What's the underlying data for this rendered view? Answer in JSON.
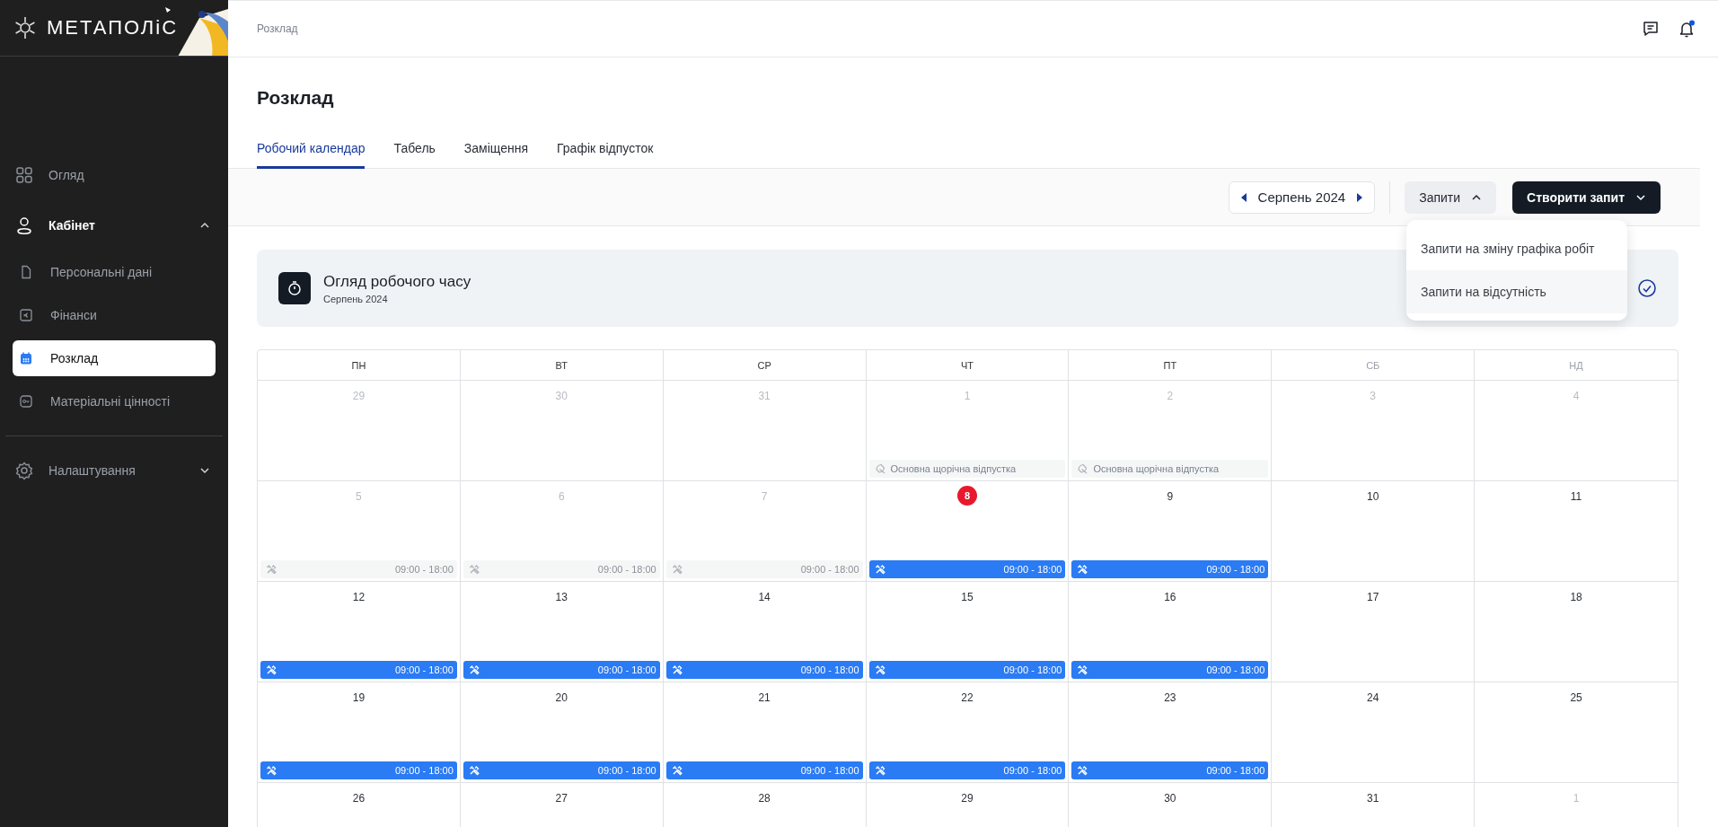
{
  "sidebar": {
    "logo": "МЕТАПОЛіС",
    "items": [
      {
        "label": "Огляд",
        "selected": false
      },
      {
        "label": "Кабінет",
        "selected": false,
        "expanded": true,
        "children": [
          {
            "label": "Персональні дані",
            "selected": false
          },
          {
            "label": "Фінанси",
            "selected": false
          },
          {
            "label": "Розклад",
            "selected": true
          },
          {
            "label": "Матеріальні цінності",
            "selected": false
          }
        ]
      },
      {
        "label": "Налаштування",
        "selected": false,
        "expanded": false
      }
    ]
  },
  "header": {
    "breadcrumb": "Розклад",
    "notifications": {
      "unread": true
    }
  },
  "page_title": "Розклад",
  "tabs": [
    {
      "label": "Робочий календар",
      "selected": true
    },
    {
      "label": "Табель",
      "selected": false
    },
    {
      "label": "Заміщення",
      "selected": false
    },
    {
      "label": "Графік відпусток",
      "selected": false
    }
  ],
  "toolbar": {
    "month": "Серпень 2024",
    "requests_button": {
      "label": "Запити",
      "expanded": true
    },
    "create_button": {
      "label": "Створити запит"
    },
    "requests_menu": [
      {
        "label": "Запити на зміну графіка робіт",
        "highlighted": false
      },
      {
        "label": "Запити на відсутність",
        "highlighted": true
      }
    ]
  },
  "overview": {
    "title": "Огляд робочого часу",
    "subtitle": "Серпень 2024"
  },
  "calendar": {
    "weekdays": [
      {
        "label": "ПН",
        "weekend": false
      },
      {
        "label": "ВТ",
        "weekend": false
      },
      {
        "label": "СР",
        "weekend": false
      },
      {
        "label": "ЧТ",
        "weekend": false
      },
      {
        "label": "ПТ",
        "weekend": false
      },
      {
        "label": "СБ",
        "weekend": true
      },
      {
        "label": "НД",
        "weekend": true
      }
    ],
    "weeks": [
      [
        {
          "number": "29",
          "muted": true,
          "today": false
        },
        {
          "number": "30",
          "muted": true,
          "today": false
        },
        {
          "number": "31",
          "muted": true,
          "today": false
        },
        {
          "number": "1",
          "muted": true,
          "today": false,
          "event": {
            "kind": "vacation",
            "label": "Основна щорічна відпустка"
          }
        },
        {
          "number": "2",
          "muted": true,
          "today": false,
          "event": {
            "kind": "vacation",
            "label": "Основна щорічна відпустка"
          }
        },
        {
          "number": "3",
          "muted": true,
          "today": false
        },
        {
          "number": "4",
          "muted": true,
          "today": false
        }
      ],
      [
        {
          "number": "5",
          "muted": true,
          "today": false,
          "event": {
            "kind": "shift",
            "time": "09:00 - 18:00",
            "past": true
          }
        },
        {
          "number": "6",
          "muted": true,
          "today": false,
          "event": {
            "kind": "shift",
            "time": "09:00 - 18:00",
            "past": true
          }
        },
        {
          "number": "7",
          "muted": true,
          "today": false,
          "event": {
            "kind": "shift",
            "time": "09:00 - 18:00",
            "past": true
          }
        },
        {
          "number": "8",
          "muted": false,
          "today": true,
          "event": {
            "kind": "shift",
            "time": "09:00 - 18:00",
            "past": false
          }
        },
        {
          "number": "9",
          "muted": false,
          "today": false,
          "event": {
            "kind": "shift",
            "time": "09:00 - 18:00",
            "past": false
          }
        },
        {
          "number": "10",
          "muted": false,
          "today": false
        },
        {
          "number": "11",
          "muted": false,
          "today": false
        }
      ],
      [
        {
          "number": "12",
          "muted": false,
          "today": false,
          "event": {
            "kind": "shift",
            "time": "09:00 - 18:00",
            "past": false
          }
        },
        {
          "number": "13",
          "muted": false,
          "today": false,
          "event": {
            "kind": "shift",
            "time": "09:00 - 18:00",
            "past": false
          }
        },
        {
          "number": "14",
          "muted": false,
          "today": false,
          "event": {
            "kind": "shift",
            "time": "09:00 - 18:00",
            "past": false
          }
        },
        {
          "number": "15",
          "muted": false,
          "today": false,
          "event": {
            "kind": "shift",
            "time": "09:00 - 18:00",
            "past": false
          }
        },
        {
          "number": "16",
          "muted": false,
          "today": false,
          "event": {
            "kind": "shift",
            "time": "09:00 - 18:00",
            "past": false
          }
        },
        {
          "number": "17",
          "muted": false,
          "today": false
        },
        {
          "number": "18",
          "muted": false,
          "today": false
        }
      ],
      [
        {
          "number": "19",
          "muted": false,
          "today": false,
          "event": {
            "kind": "shift",
            "time": "09:00 - 18:00",
            "past": false
          }
        },
        {
          "number": "20",
          "muted": false,
          "today": false,
          "event": {
            "kind": "shift",
            "time": "09:00 - 18:00",
            "past": false
          }
        },
        {
          "number": "21",
          "muted": false,
          "today": false,
          "event": {
            "kind": "shift",
            "time": "09:00 - 18:00",
            "past": false
          }
        },
        {
          "number": "22",
          "muted": false,
          "today": false,
          "event": {
            "kind": "shift",
            "time": "09:00 - 18:00",
            "past": false
          }
        },
        {
          "number": "23",
          "muted": false,
          "today": false,
          "event": {
            "kind": "shift",
            "time": "09:00 - 18:00",
            "past": false
          }
        },
        {
          "number": "24",
          "muted": false,
          "today": false
        },
        {
          "number": "25",
          "muted": false,
          "today": false
        }
      ],
      [
        {
          "number": "26",
          "muted": false,
          "today": false
        },
        {
          "number": "27",
          "muted": false,
          "today": false
        },
        {
          "number": "28",
          "muted": false,
          "today": false
        },
        {
          "number": "29",
          "muted": false,
          "today": false
        },
        {
          "number": "30",
          "muted": false,
          "today": false
        },
        {
          "number": "31",
          "muted": false,
          "today": false
        },
        {
          "number": "1",
          "muted": true,
          "today": false
        }
      ]
    ]
  }
}
